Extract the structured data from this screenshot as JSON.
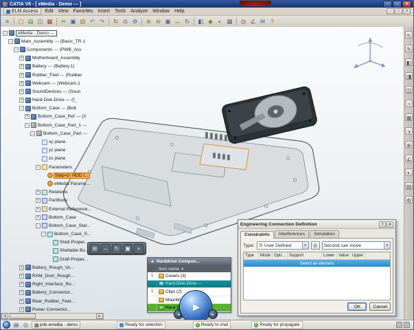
{
  "colors": {
    "titlebar": "#2e57a4",
    "selection_blue": "#3aa0d8",
    "teal_row_bg": "#0e8a93",
    "green_row_bg": "#58b133",
    "orange_highlight": "#f2a947"
  },
  "window": {
    "title": "CATIA V6 - [ eMedia - Demo --- ]",
    "controls": [
      "–",
      "□",
      "✕"
    ]
  },
  "menubar": {
    "elm_access": "ELM Access",
    "menus": [
      "Edit",
      "View",
      "Favorites",
      "Insert",
      "Tools",
      "Analyze",
      "Window",
      "Help"
    ],
    "child_controls": [
      "–",
      "□",
      "✕"
    ]
  },
  "toolbar": {
    "icons": [
      "tree-toggle",
      "new",
      "open",
      "save",
      "print",
      "cut",
      "copy",
      "paste",
      "undo",
      "redo",
      "refresh",
      "search",
      "settings",
      "zoom-in",
      "zoom-out",
      "fit-all",
      "pan",
      "rotate",
      "front-view",
      "iso-view",
      "shaded",
      "wireframe",
      "hide-show",
      "measure",
      "chat",
      "help"
    ]
  },
  "right_toolbar": {
    "icons": [
      "pointer",
      "sketch",
      "pad",
      "pocket",
      "shell",
      "fillet",
      "pattern",
      "mirror",
      "boolean",
      "measure",
      "material",
      "views",
      "options"
    ]
  },
  "mini_toolbar": {
    "icons": [
      "zoom-area",
      "pan",
      "rotate",
      "zoom-fit",
      "more"
    ]
  },
  "tree": {
    "items": [
      {
        "label": "eMedia - Demo ---",
        "level": 0,
        "exp": "-",
        "icon": "product",
        "boxed": true
      },
      {
        "label": "Main_Assembly --- (Basic_TR.1",
        "level": 1,
        "exp": "-",
        "icon": "product"
      },
      {
        "label": "Components --- (PWB_Ass",
        "level": 2,
        "exp": "-",
        "icon": "product"
      },
      {
        "label": "Motherboard_Assembly",
        "level": 3,
        "exp": "+",
        "icon": "product"
      },
      {
        "label": "Battery --- (Battery.1)",
        "level": 3,
        "exp": "+",
        "icon": "product"
      },
      {
        "label": "Rubber_Feet --- (Rubber",
        "level": 3,
        "exp": "+",
        "icon": "product"
      },
      {
        "label": "Webcam --- (Webcam.1",
        "level": 3,
        "exp": "+",
        "icon": "product"
      },
      {
        "label": "SoundDevices --- (Soun",
        "level": 3,
        "exp": "+",
        "icon": "product"
      },
      {
        "label": "Hard-Disk-Drive --- (f_",
        "level": 3,
        "exp": "+",
        "icon": "product"
      },
      {
        "label": "Bottom_Case --- (Bott",
        "level": 3,
        "exp": "-",
        "icon": "product"
      },
      {
        "label": "Bottom_Case_Ref --- (3",
        "level": 4,
        "exp": "+",
        "icon": "product"
      },
      {
        "label": "Bottom_Case_Part_1 ---",
        "level": 4,
        "exp": "-",
        "icon": "part"
      },
      {
        "label": "Bottom_Case_Part ---",
        "level": 5,
        "exp": "-",
        "icon": "part"
      },
      {
        "label": "xy plane",
        "level": 6,
        "icon": "plane"
      },
      {
        "label": "yz plane",
        "level": 6,
        "icon": "plane"
      },
      {
        "label": "zx plane",
        "level": 6,
        "icon": "plane"
      },
      {
        "label": "Parameters",
        "level": 6,
        "exp": "-",
        "icon": "params"
      },
      {
        "label": "Step=2- HDD I...",
        "level": 7,
        "icon": "param",
        "hl": "orange"
      },
      {
        "label": "eMedia Parame...",
        "level": 7,
        "icon": "param"
      },
      {
        "label": "Relations",
        "level": 6,
        "exp": "+",
        "icon": "relations"
      },
      {
        "label": "PartBody",
        "level": 6,
        "exp": "+",
        "icon": "body"
      },
      {
        "label": "External Reference...",
        "level": 6,
        "exp": "+",
        "icon": "reference"
      },
      {
        "label": "Bottom_Case",
        "level": 6,
        "exp": "+",
        "icon": "body"
      },
      {
        "label": "Bottom_Case_Star...",
        "level": 6,
        "exp": "-",
        "icon": "body"
      },
      {
        "label": "Bottom_Case_S...",
        "level": 7,
        "exp": "-",
        "icon": "feature"
      },
      {
        "label": "Shell Proper...",
        "level": 8,
        "icon": "feature"
      },
      {
        "label": "Shellable Bo...",
        "level": 8,
        "icon": "feature"
      },
      {
        "label": "Draft Proper...",
        "level": 8,
        "icon": "feature"
      },
      {
        "label": "Battery_Rough_Vo...",
        "level": 3,
        "exp": "+",
        "icon": "product"
      },
      {
        "label": "RAM_Door_Rough...",
        "level": 3,
        "exp": "+",
        "icon": "product"
      },
      {
        "label": "Right_Interface_Ro...",
        "level": 3,
        "exp": "+",
        "icon": "product"
      },
      {
        "label": "Battery_Connector...",
        "level": 3,
        "exp": "+",
        "icon": "product"
      },
      {
        "label": "Rear_Rubber_Feet...",
        "level": 3,
        "exp": "+",
        "icon": "product"
      },
      {
        "label": "Power Connector...",
        "level": 3,
        "exp": "+",
        "icon": "product"
      }
    ]
  },
  "item_panel": {
    "title": "Harddrive Compon...",
    "sort_indicator": "▲",
    "columns": {
      "item_name": "Item name"
    },
    "rows": [
      {
        "num": "1",
        "icon": "folder",
        "label": "Covers (3)"
      },
      {
        "num": "",
        "icon": "part",
        "label": "Hard-Disk-Drive ---",
        "style": "teal"
      },
      {
        "num": "1",
        "icon": "folder",
        "label": "Clips (2)"
      },
      {
        "num": "",
        "icon": "folder",
        "label": "Mounting Hard..."
      },
      {
        "num": "",
        "icon": "part-green",
        "label": "Hard Disk Drive",
        "style": "green"
      }
    ]
  },
  "dialog": {
    "title": "Engineering Connection Definition",
    "title_buttons": [
      "?",
      "✕"
    ],
    "tabs": [
      {
        "label": "Constraints",
        "active": true
      },
      {
        "label": "Interferences",
        "active": false
      },
      {
        "label": "Simulation",
        "active": false
      }
    ],
    "type_label": "Type:",
    "type_value": "User Defined",
    "move_value": "Second can move",
    "columns": [
      "Type",
      "Mode",
      "Opti...",
      "Support",
      "Lower",
      "Value",
      "Upper"
    ],
    "placeholder_row": "Select an element",
    "ok_label": "OK",
    "cancel_label": "Cancel"
  },
  "statusbar": {
    "taskbar_item": "pnb emedia - demo",
    "messages": [
      "Ready for selection",
      "Ready to chat",
      "Ready for propagate"
    ]
  }
}
